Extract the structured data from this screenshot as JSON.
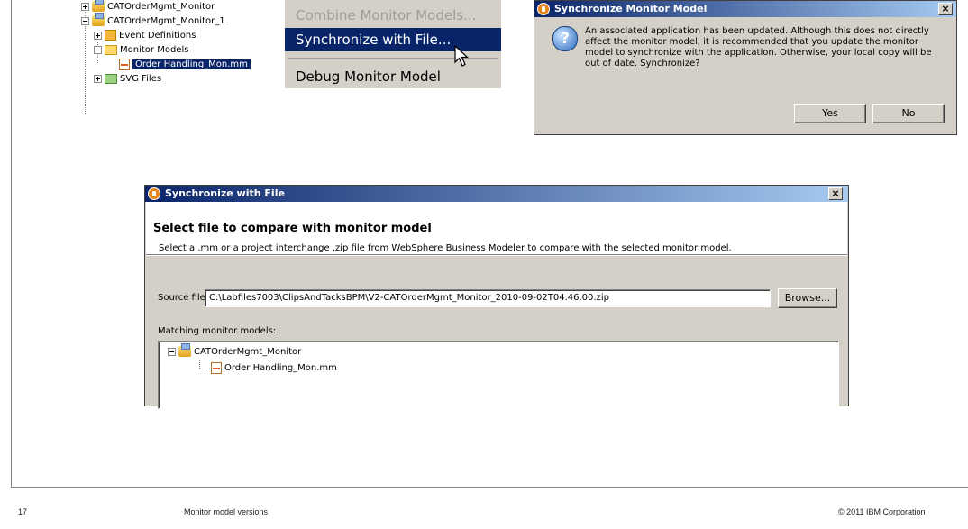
{
  "tree": {
    "items": [
      {
        "label": "CATOrderMgmt_Monitor"
      },
      {
        "label": "CATOrderMgmt_Monitor_1"
      },
      {
        "label": "Event Definitions"
      },
      {
        "label": "Monitor Models"
      },
      {
        "label": "Order Handling_Mon.mm"
      },
      {
        "label": "SVG Files"
      }
    ]
  },
  "context_menu": {
    "items": [
      {
        "label": "Combine Monitor Models...",
        "state": "disabled"
      },
      {
        "label": "Synchronize with File...",
        "state": "highlighted"
      },
      {
        "label": "Debug Monitor Model",
        "state": "normal"
      }
    ]
  },
  "sync_monitor_dialog": {
    "title": "Synchronize Monitor Model",
    "icon": "question-icon",
    "message": "An associated application has been updated. Although this does not directly affect the monitor model, it is recommended that you update the monitor model to synchronize with the application. Otherwise, your local copy will be out of date. Synchronize?",
    "yes_label": "Yes",
    "no_label": "No",
    "close_glyph": "×"
  },
  "sync_file_dialog": {
    "title": "Synchronize with File",
    "heading": "Select file to compare with monitor model",
    "description": "Select a .mm or a project interchange .zip file from WebSphere Business Modeler to compare with the selected monitor model.",
    "source_label": "Source file",
    "source_value": "C:\\Labfiles7003\\ClipsAndTacksBPM\\V2-CATOrderMgmt_Monitor_2010-09-02T04.46.00.zip",
    "browse_label": "Browse...",
    "matching_label": "Matching monitor models:",
    "matching_tree": [
      {
        "label": "CATOrderMgmt_Monitor"
      },
      {
        "label": "Order Handling_Mon.mm"
      }
    ],
    "close_glyph": "×"
  },
  "footer": {
    "page_number": "17",
    "title": "Monitor model versions",
    "copyright": "© 2011 IBM Corporation"
  },
  "colors": {
    "selection": "#0a246a",
    "dialog_face": "#d4d0c8",
    "titlebar_start": "#0a246a",
    "titlebar_end": "#a6caf0"
  }
}
